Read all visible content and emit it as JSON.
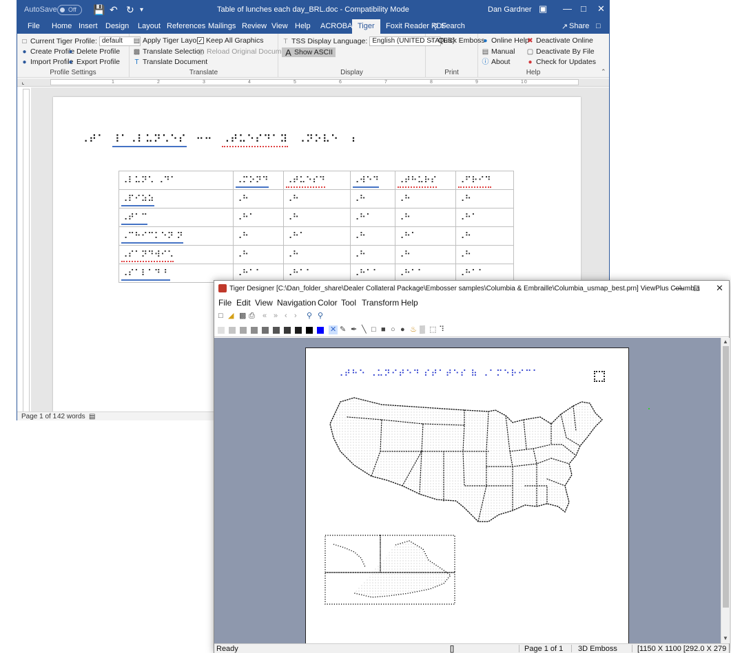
{
  "word": {
    "autosave_label": "AutoSave",
    "autosave_state": "Off",
    "doc_title": "Table of lunches each day_BRL.doc  -  Compatibility Mode",
    "user": "Dan Gardner",
    "tabs": [
      "File",
      "Home",
      "Insert",
      "Design",
      "Layout",
      "References",
      "Mailings",
      "Review",
      "View",
      "Help",
      "ACROBAT",
      "Tiger",
      "Foxit Reader PDF"
    ],
    "active_tab": "Tiger",
    "search_label": "Search",
    "share_label": "Share",
    "ribbon": {
      "profile_settings": {
        "label": "Profile Settings",
        "current_profile_label": "Current Tiger Profile:",
        "current_profile_value": "default",
        "create_profile": "Create Profile",
        "delete_profile": "Delete Profile",
        "import_profile": "Import Profile",
        "export_profile": "Export Profile"
      },
      "translate": {
        "label": "Translate",
        "apply_layout": "Apply Tiger Layout",
        "keep_graphics": "Keep All Graphics",
        "translate_selection": "Translate Selection",
        "reload_document": "Reload Original Document",
        "translate_document": "Translate Document"
      },
      "display": {
        "label": "Display",
        "tss_label": "TSS Display Language:",
        "tss_value": "English (UNITED STATES)",
        "show_ascii": "Show ASCII"
      },
      "print": {
        "label": "Print",
        "quick_emboss": "Quick Emboss"
      },
      "help": {
        "label": "Help",
        "online_help": "Online Help",
        "deactivate_online": "Deactivate Online",
        "manual": "Manual",
        "deactivate_file": "Deactivate By File",
        "about": "About",
        "check_updates": "Check for Updates"
      }
    },
    "ruler_numbers": [
      "1",
      "2",
      "3",
      "4",
      "5",
      "6",
      "7",
      "8",
      "9",
      "10"
    ],
    "document": {
      "title_braille": [
        "⠠⠞⠁",
        "⠸⠁⠠⠇⠥⠝⠡⠑⠎",
        "⠒⠒",
        "⠠⠞⠥⠑⠎⠙⠁⠽",
        "⠠⠝⠕⠧⠑",
        "⠆"
      ],
      "table_header": [
        "⠠⠇⠥⠝⠡ ⠠⠙⠁",
        "⠠⠍⠕⠝⠙",
        "⠠⠞⠥⠑⠎⠙",
        "⠠⠺⠑⠙",
        "⠠⠞⠓⠥⠗⠎",
        "⠠⠋⠗⠊⠙"
      ],
      "table_rows": [
        [
          "⠠⠏⠊⠵⠵",
          "⠠⠓",
          "⠠⠓",
          "⠠⠓",
          "⠠⠓",
          "⠠⠓"
        ],
        [
          "⠠⠞⠁⠉",
          "⠠⠓⠁",
          "⠠⠓",
          "⠠⠓⠁",
          "⠠⠓",
          "⠠⠓⠁"
        ],
        [
          "⠠⠉⠓⠊⠉⠅⠑⠝ ⠝",
          "⠠⠓",
          "⠠⠓⠁",
          "⠠⠓",
          "⠠⠓⠁",
          "⠠⠓"
        ],
        [
          "⠠⠎⠁⠝⠙⠺⠊⠡",
          "⠠⠓",
          "⠠⠓",
          "⠠⠓",
          "⠠⠓",
          "⠠⠓"
        ],
        [
          "⠠⠎⠁⠇⠁⠙ ⠃",
          "⠠⠓⠁⠁",
          "⠠⠓⠁⠁",
          "⠠⠓⠁⠁",
          "⠠⠓⠁⠁",
          "⠠⠓⠁⠁"
        ]
      ]
    },
    "status": {
      "page": "Page 1 of 1",
      "words": "42 words"
    }
  },
  "tiger": {
    "title": "Tiger Designer [C:\\Dan_folder_share\\Dealer Collateral Package\\Embosser samples\\Columbia & Embraille\\Columbia_usmap_best.prn] ViewPlus Columbia",
    "menu": [
      "File",
      "Edit",
      "View",
      "Navigation",
      "Color",
      "Tool",
      "Transform",
      "Help"
    ],
    "map_title_braille": "⠠⠞⠓⠑ ⠠⠥⠝⠊⠞⠑⠙ ⠎⠞⠁⠞⠑⠎ ⠷ ⠠⠁⠍⠑⠗⠊⠉⠁",
    "status": {
      "ready": "Ready",
      "mode_glyph": "[]",
      "page": "Page 1 of 1",
      "emboss": "3D Emboss",
      "dims": "[1150 X 1100  [292.0 X 279.4"
    },
    "colors": {
      "palette": [
        "#e0e0e0",
        "#c4c4c4",
        "#a8a8a8",
        "#8c8c8c",
        "#707070",
        "#545454",
        "#383838",
        "#1c1c1c",
        "#000000",
        "#0000ff"
      ]
    }
  }
}
